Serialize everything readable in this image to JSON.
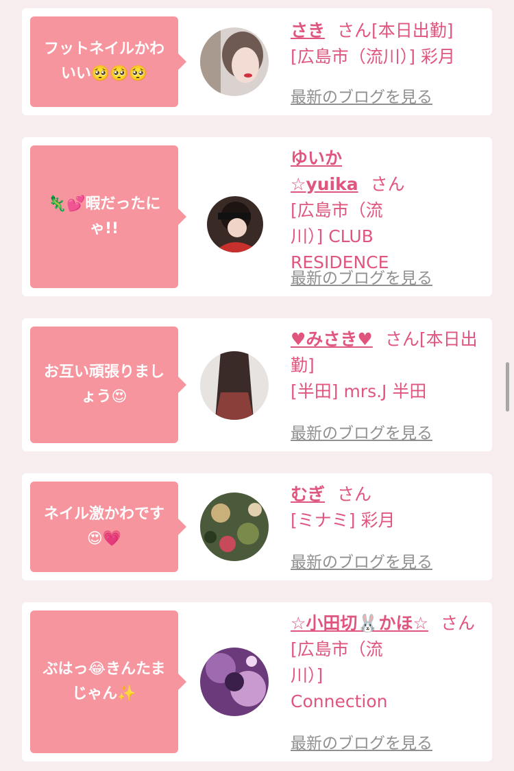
{
  "items": [
    {
      "comment": "フットネイルかわいい🥺🥺🥺",
      "name": "さき",
      "suffix": "さん[本日出勤]",
      "shop": "[広島市（流川）] 彩月",
      "blog_link": "最新のブログを見る"
    },
    {
      "comment": "🦎💕暇だったにゃ!!",
      "name": "ゆいか☆yuika",
      "suffix": "さん",
      "shop": "[広島市（流川）] CLUB RESIDENCE",
      "blog_link": "最新のブログを見る"
    },
    {
      "comment": "お互い頑張りましょう😍",
      "name": "♥みさき♥",
      "suffix": "さん[本日出勤]",
      "shop": "[半田] mrs.J 半田",
      "blog_link": "最新のブログを見る"
    },
    {
      "comment": "ネイル激かわです😍💗",
      "name": "むぎ",
      "suffix": "さん",
      "shop": "[ミナミ] 彩月",
      "blog_link": "最新のブログを見る"
    },
    {
      "comment": "ぶはっ😂きんたまじゃん✨",
      "name": "☆小田切🐰かほ☆",
      "suffix": "さん",
      "shop": "[広島市（流川）] Connection",
      "blog_link": "最新のブログを見る"
    }
  ],
  "colors": {
    "accent": "#e0557e",
    "bubble": "#f7959f",
    "link_gray": "#8f8f8f",
    "background": "#f7ecee"
  }
}
